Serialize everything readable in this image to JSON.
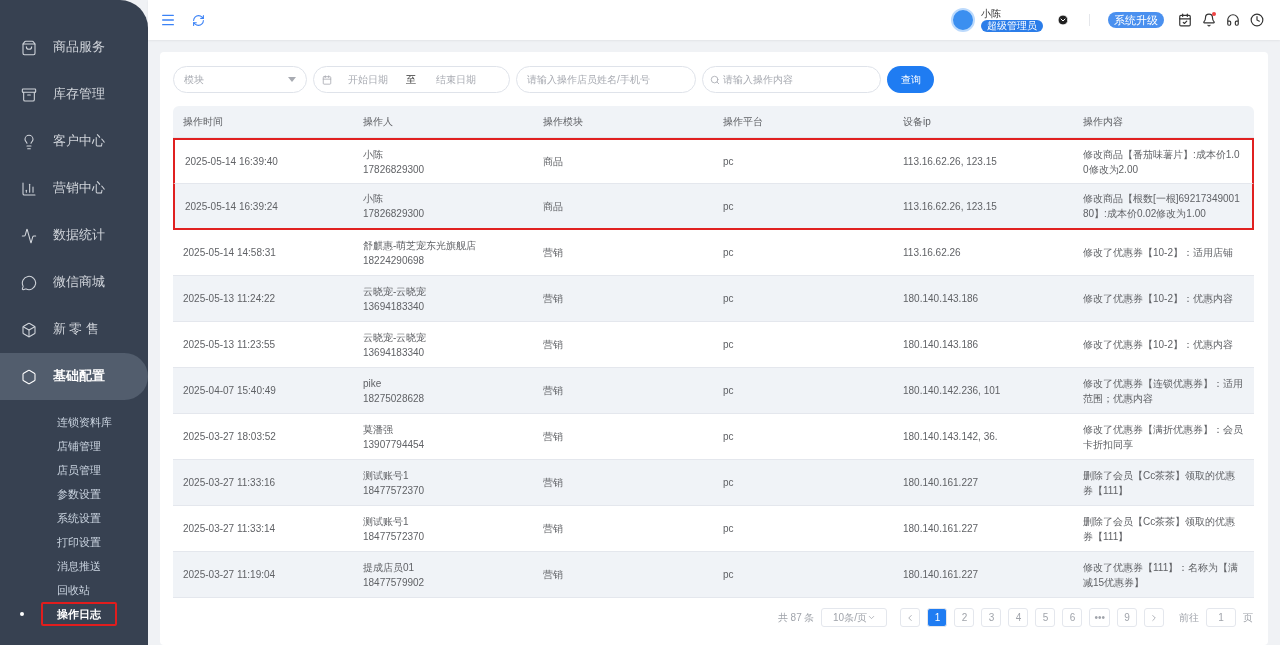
{
  "sidebar": {
    "items": [
      {
        "label": "商品服务",
        "selected": false
      },
      {
        "label": "库存管理",
        "selected": false
      },
      {
        "label": "客户中心",
        "selected": false
      },
      {
        "label": "营销中心",
        "selected": false
      },
      {
        "label": "数据统计",
        "selected": false
      },
      {
        "label": "微信商城",
        "selected": false
      },
      {
        "label": "新 零 售",
        "selected": false
      },
      {
        "label": "基础配置",
        "selected": true
      }
    ],
    "sub_items": [
      {
        "label": "连锁资料库",
        "selected": false,
        "highlighted": false
      },
      {
        "label": "店铺管理",
        "selected": false,
        "highlighted": false
      },
      {
        "label": "店员管理",
        "selected": false,
        "highlighted": false
      },
      {
        "label": "参数设置",
        "selected": false,
        "highlighted": false
      },
      {
        "label": "系统设置",
        "selected": false,
        "highlighted": false
      },
      {
        "label": "打印设置",
        "selected": false,
        "highlighted": false
      },
      {
        "label": "消息推送",
        "selected": false,
        "highlighted": false
      },
      {
        "label": "回收站",
        "selected": false,
        "highlighted": false
      },
      {
        "label": "操作日志",
        "selected": true,
        "highlighted": true
      }
    ]
  },
  "header": {
    "user_name": "小陈",
    "role": "超级管理员",
    "upgrade_button": "系统升级",
    "notification_dot": true
  },
  "filters": {
    "module": {
      "placeholder": "模块"
    },
    "start_date": {
      "placeholder": "开始日期"
    },
    "date_separator": "至",
    "end_date": {
      "placeholder": "结束日期"
    },
    "staff": {
      "placeholder": "请输入操作店员姓名/手机号"
    },
    "content": {
      "placeholder": "请输入操作内容"
    },
    "query_button": "查询"
  },
  "table": {
    "columns": [
      "操作时间",
      "操作人",
      "操作模块",
      "操作平台",
      "设备ip",
      "操作内容"
    ],
    "rows": [
      {
        "time": "2025-05-14 16:39:40",
        "operator": "小陈",
        "phone": "17826829300",
        "module": "商品",
        "platform": "pc",
        "ip": "113.16.62.26, 123.15",
        "content": "修改商品【番茄味薯片】:成本价1.00修改为2.00",
        "highlighted": true
      },
      {
        "time": "2025-05-14 16:39:24",
        "operator": "小陈",
        "phone": "17826829300",
        "module": "商品",
        "platform": "pc",
        "ip": "113.16.62.26, 123.15",
        "content": "修改商品【根数[一根]6921734900180】:成本价0.02修改为1.00",
        "highlighted": true
      },
      {
        "time": "2025-05-14 14:58:31",
        "operator": "舒麒惠-萌芝宠东光旗舰店",
        "phone": "18224290698",
        "module": "营销",
        "platform": "pc",
        "ip": "113.16.62.26",
        "content": "修改了优惠券【10-2】：适用店铺",
        "highlighted": false
      },
      {
        "time": "2025-05-13 11:24:22",
        "operator": "云晓宠-云晓宠",
        "phone": "13694183340",
        "module": "营销",
        "platform": "pc",
        "ip": "180.140.143.186",
        "content": "修改了优惠券【10-2】：优惠内容",
        "highlighted": false
      },
      {
        "time": "2025-05-13 11:23:55",
        "operator": "云晓宠-云晓宠",
        "phone": "13694183340",
        "module": "营销",
        "platform": "pc",
        "ip": "180.140.143.186",
        "content": "修改了优惠券【10-2】：优惠内容",
        "highlighted": false
      },
      {
        "time": "2025-04-07 15:40:49",
        "operator": "pike",
        "phone": "18275028628",
        "module": "营销",
        "platform": "pc",
        "ip": "180.140.142.236, 101",
        "content": "修改了优惠券【连锁优惠券】：适用范围；优惠内容",
        "highlighted": false
      },
      {
        "time": "2025-03-27 18:03:52",
        "operator": "莫潘强",
        "phone": "13907794454",
        "module": "营销",
        "platform": "pc",
        "ip": "180.140.143.142, 36.",
        "content": "修改了优惠券【满折优惠券】：会员卡折扣同享",
        "highlighted": false
      },
      {
        "time": "2025-03-27 11:33:16",
        "operator": "测试账号1",
        "phone": "18477572370",
        "module": "营销",
        "platform": "pc",
        "ip": "180.140.161.227",
        "content": "删除了会员【Cc茶茶】领取的优惠券【111】",
        "highlighted": false
      },
      {
        "time": "2025-03-27 11:33:14",
        "operator": "测试账号1",
        "phone": "18477572370",
        "module": "营销",
        "platform": "pc",
        "ip": "180.140.161.227",
        "content": "删除了会员【Cc茶茶】领取的优惠券【111】",
        "highlighted": false
      },
      {
        "time": "2025-03-27 11:19:04",
        "operator": "提成店员01",
        "phone": "18477579902",
        "module": "营销",
        "platform": "pc",
        "ip": "180.140.161.227",
        "content": "修改了优惠券【111】：名称为【满减15优惠券】",
        "highlighted": false
      }
    ]
  },
  "pagination": {
    "total": "共 87 条",
    "page_size": "10条/页",
    "pages": [
      {
        "label": "1",
        "selected": true
      },
      {
        "label": "2",
        "selected": false
      },
      {
        "label": "3",
        "selected": false
      },
      {
        "label": "4",
        "selected": false
      },
      {
        "label": "5",
        "selected": false
      },
      {
        "label": "6",
        "selected": false
      },
      {
        "label": "•••",
        "selected": false
      },
      {
        "label": "9",
        "selected": false
      }
    ],
    "goto_label": "前往",
    "goto_value": "1",
    "page_unit": "页"
  }
}
